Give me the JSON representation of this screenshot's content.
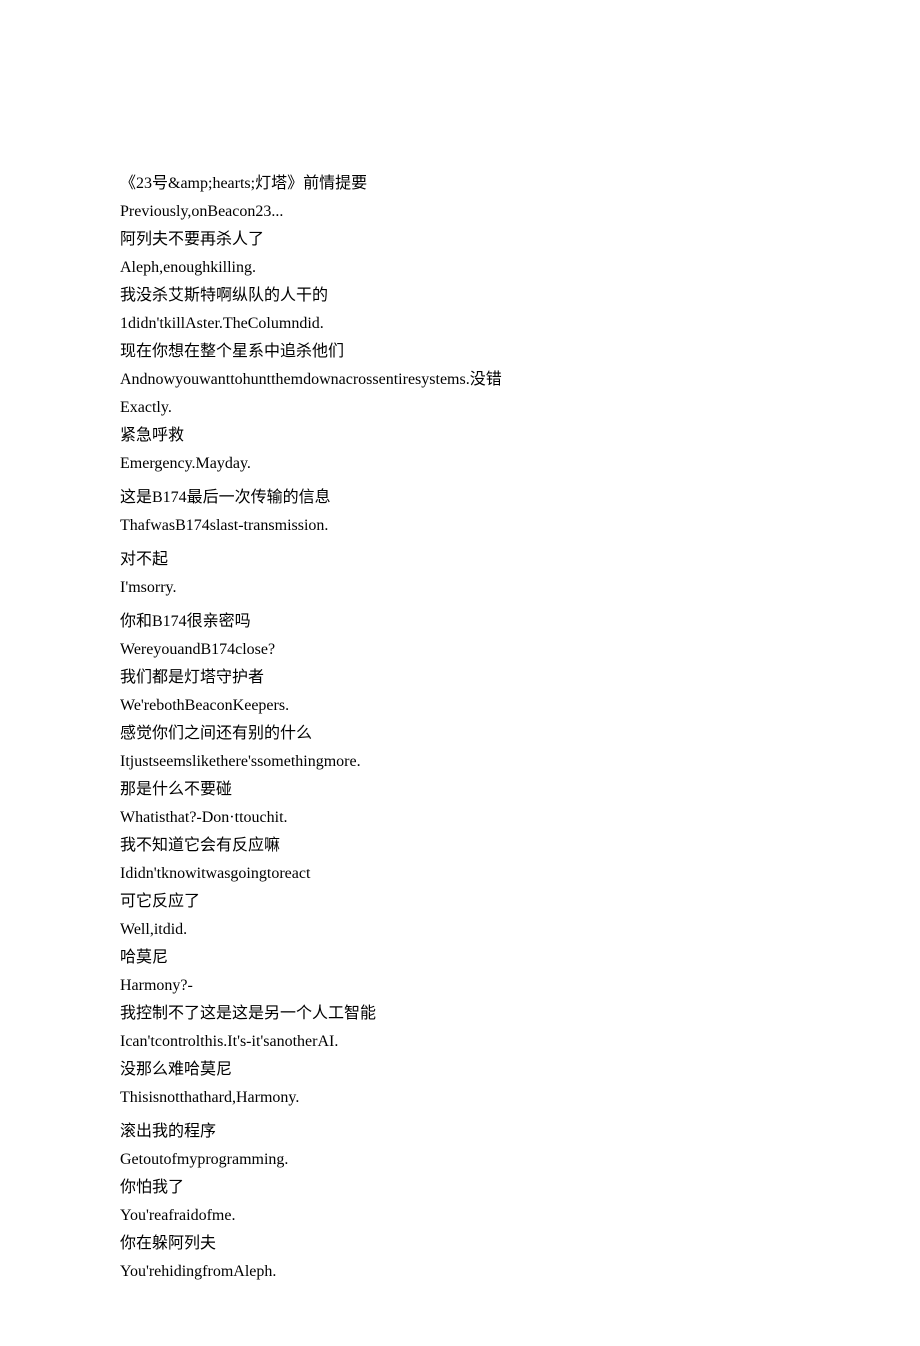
{
  "lines": [
    "《23号&amp;hearts;灯塔》前情提要",
    "Previously,onBeacon23...",
    "阿列夫不要再杀人了",
    "Aleph,enoughkilling.",
    "我没杀艾斯特啊纵队的人干的",
    "1didn'tkillAster.TheColumndid.",
    "现在你想在整个星系中追杀他们",
    "Andnowyouwanttohuntthemdownacrossentiresystems.没错",
    "Exactly.",
    "紧急呼救",
    "Emergency.Mayday.",
    "",
    "这是B174最后一次传输的信息",
    "ThafwasB174slast-transmission.",
    "",
    "对不起",
    "I'msorry.",
    "",
    "你和B174很亲密吗",
    "WereyouandB174close?",
    "我们都是灯塔守护者",
    "We'rebothBeaconKeepers.",
    "感觉你们之间还有别的什么",
    "Itjustseemslikethere'ssomethingmore.",
    "那是什么不要碰",
    "Whatisthat?-Don·ttouchit.",
    "我不知道它会有反应嘛",
    "Ididn'tknowitwasgoingtoreact",
    "可它反应了",
    "Well,itdid.",
    "哈莫尼",
    "Harmony?-",
    "我控制不了这是这是另一个人工智能",
    "Ican'tcontrolthis.It's-it'sanotherAI.",
    "没那么难哈莫尼",
    "Thisisnotthathard,Harmony.",
    "",
    "滚出我的程序",
    "Getoutofmyprogramming.",
    "你怕我了",
    "You'reafraidofme.",
    "你在躲阿列夫",
    "You'rehidingfromAleph."
  ]
}
